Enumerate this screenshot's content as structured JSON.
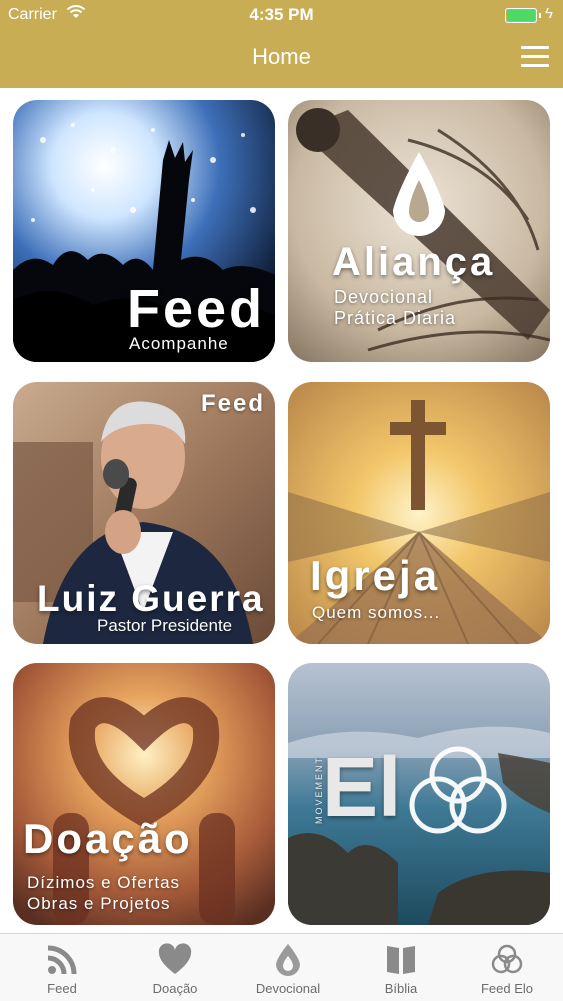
{
  "status_bar": {
    "carrier": "Carrier",
    "time": "4:35 PM"
  },
  "nav": {
    "title": "Home"
  },
  "tiles": [
    {
      "title": "Feed",
      "subtitle": "Acompanhe"
    },
    {
      "title": "Aliança",
      "subtitle": "Devocional",
      "subtitle2": "Prática Diaria"
    },
    {
      "top_label": "Feed",
      "title": "Luiz Guerra",
      "subtitle": "Pastor Presidente"
    },
    {
      "title": "Igreja",
      "subtitle": "Quem somos..."
    },
    {
      "title": "Doação",
      "subtitle": "Dízimos e Ofertas",
      "subtitle2": "Obras e Projetos"
    },
    {
      "title": "El",
      "side_label": "MOVEMENT"
    }
  ],
  "tabbar": {
    "items": [
      {
        "label": "Feed",
        "icon": "rss-icon"
      },
      {
        "label": "Doação",
        "icon": "heart-icon"
      },
      {
        "label": "Devocional",
        "icon": "flame-drop-icon"
      },
      {
        "label": "Bíblia",
        "icon": "book-icon"
      },
      {
        "label": "Feed Elo",
        "icon": "rings-icon"
      }
    ]
  },
  "colors": {
    "header": "#c9ad55",
    "tab_label": "#6b6b6b",
    "tab_icon": "#8a8a8a",
    "battery": "#4cd964"
  }
}
